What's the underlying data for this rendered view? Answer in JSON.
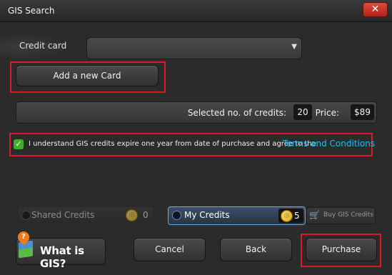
{
  "window": {
    "title": "GIS Search",
    "close_label": "✕"
  },
  "credit_card": {
    "label": "Credit card",
    "value": "",
    "caret": "▼"
  },
  "add_card_label": "Add a new Card",
  "credits": {
    "selected_label": "Selected no. of credits:",
    "selected_value": "20",
    "price_label": "Price:",
    "price_value": "$89"
  },
  "terms": {
    "checked": true,
    "check_glyph": "✓",
    "text": "I understand GIS credits expire one year from date of purchase and agree to the",
    "link_text": "Terms and Conditions"
  },
  "shared_credits": {
    "label": "Shared Credits",
    "count": "0",
    "icon": "coin-icon"
  },
  "my_credits": {
    "label": "My Credits",
    "count": "5",
    "icon": "coin-icon"
  },
  "buy_credits": {
    "label": "Buy GIS Credits",
    "icon": "cart-icon"
  },
  "what_is_gis": {
    "label": "What is GIS?",
    "pin_glyph": "?"
  },
  "buttons": {
    "cancel": "Cancel",
    "back": "Back",
    "purchase": "Purchase"
  },
  "colors": {
    "highlight": "#e0192a",
    "link": "#1ec0f0",
    "check": "#3bb02a",
    "close": "#c8301f"
  }
}
